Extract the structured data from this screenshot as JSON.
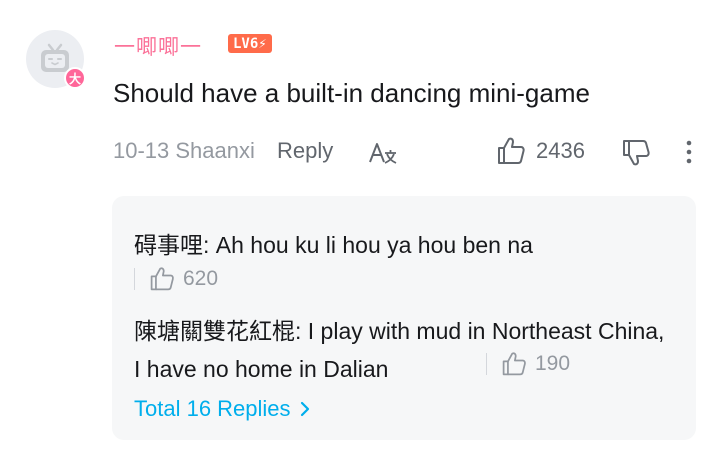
{
  "comment": {
    "username": "一唧唧一",
    "level": "LV6⚡",
    "vip_badge": "大",
    "text": "Should have a built-in dancing mini-game",
    "meta": "10-13 Shaanxi",
    "reply_label": "Reply",
    "like_count": "2436"
  },
  "replies": [
    {
      "text": "碍事哩: Ah hou ku li hou ya hou ben na",
      "likes": "620"
    },
    {
      "text": "陳塘關雙花紅棍: I play with mud in Northeast China, I have no home in Dalian",
      "likes": "190"
    }
  ],
  "total_replies": "Total 16 Replies",
  "colors": {
    "username": "#fb7299",
    "level_badge": "#ff6b4a",
    "link": "#00aeec",
    "reply_bg": "#f6f7f8"
  },
  "icons": [
    "tv-avatar-icon",
    "translate-icon",
    "thumbs-up-icon",
    "thumbs-down-icon",
    "more-vertical-icon",
    "chevron-right-icon"
  ]
}
